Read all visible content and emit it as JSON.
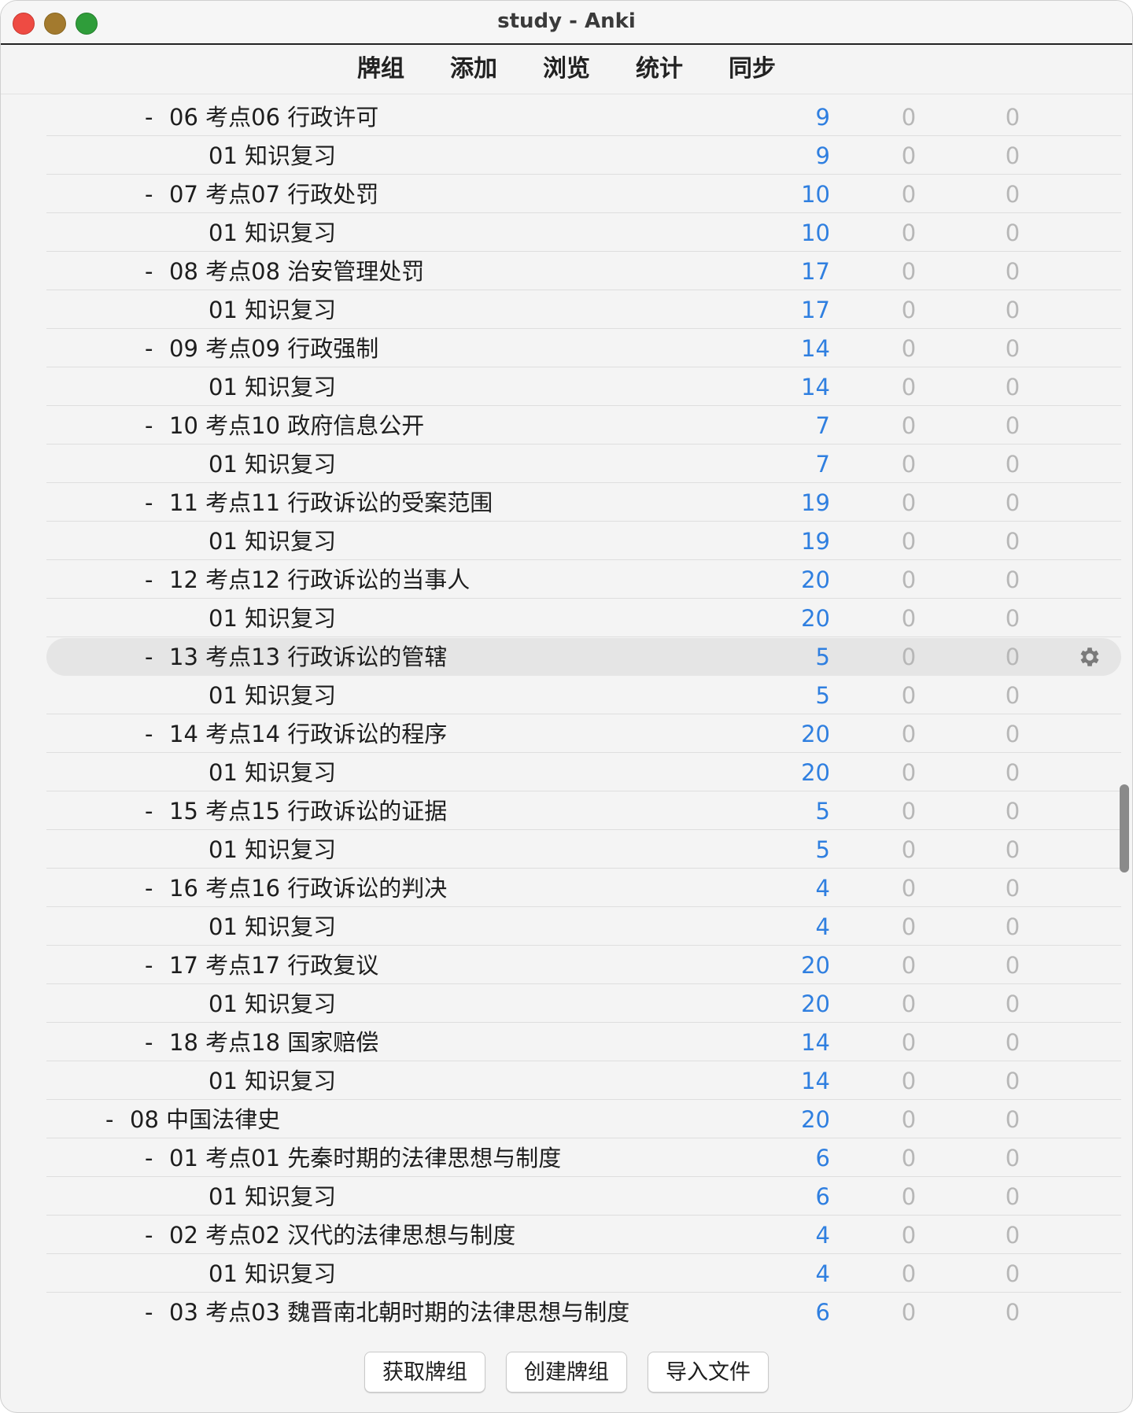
{
  "window": {
    "title": "study - Anki"
  },
  "toolbar": {
    "decks": "牌组",
    "add": "添加",
    "browse": "浏览",
    "stats": "统计",
    "sync": "同步"
  },
  "colors": {
    "due": "#2f7fe0",
    "zero": "#b7b7b7"
  },
  "decks": [
    {
      "collapse": "-",
      "name": "06 考点06 行政许可",
      "due": "9",
      "new": "0",
      "learn": "0"
    },
    {
      "collapse": "",
      "name": "01 知识复习",
      "due": "9",
      "new": "0",
      "learn": "0"
    },
    {
      "collapse": "-",
      "name": "07 考点07 行政处罚",
      "due": "10",
      "new": "0",
      "learn": "0"
    },
    {
      "collapse": "",
      "name": "01 知识复习",
      "due": "10",
      "new": "0",
      "learn": "0"
    },
    {
      "collapse": "-",
      "name": "08 考点08 治安管理处罚",
      "due": "17",
      "new": "0",
      "learn": "0"
    },
    {
      "collapse": "",
      "name": "01 知识复习",
      "due": "17",
      "new": "0",
      "learn": "0"
    },
    {
      "collapse": "-",
      "name": "09 考点09 行政强制",
      "due": "14",
      "new": "0",
      "learn": "0"
    },
    {
      "collapse": "",
      "name": "01 知识复习",
      "due": "14",
      "new": "0",
      "learn": "0"
    },
    {
      "collapse": "-",
      "name": "10 考点10 政府信息公开",
      "due": "7",
      "new": "0",
      "learn": "0"
    },
    {
      "collapse": "",
      "name": "01 知识复习",
      "due": "7",
      "new": "0",
      "learn": "0"
    },
    {
      "collapse": "-",
      "name": "11 考点11 行政诉讼的受案范围",
      "due": "19",
      "new": "0",
      "learn": "0"
    },
    {
      "collapse": "",
      "name": "01 知识复习",
      "due": "19",
      "new": "0",
      "learn": "0"
    },
    {
      "collapse": "-",
      "name": "12 考点12 行政诉讼的当事人",
      "due": "20",
      "new": "0",
      "learn": "0"
    },
    {
      "collapse": "",
      "name": "01 知识复习",
      "due": "20",
      "new": "0",
      "learn": "0"
    },
    {
      "collapse": "-",
      "name": "13 考点13 行政诉讼的管辖",
      "due": "5",
      "new": "0",
      "learn": "0"
    },
    {
      "collapse": "",
      "name": "01 知识复习",
      "due": "5",
      "new": "0",
      "learn": "0"
    },
    {
      "collapse": "-",
      "name": "14 考点14 行政诉讼的程序",
      "due": "20",
      "new": "0",
      "learn": "0"
    },
    {
      "collapse": "",
      "name": "01 知识复习",
      "due": "20",
      "new": "0",
      "learn": "0"
    },
    {
      "collapse": "-",
      "name": "15 考点15 行政诉讼的证据",
      "due": "5",
      "new": "0",
      "learn": "0"
    },
    {
      "collapse": "",
      "name": "01 知识复习",
      "due": "5",
      "new": "0",
      "learn": "0"
    },
    {
      "collapse": "-",
      "name": "16 考点16 行政诉讼的判决",
      "due": "4",
      "new": "0",
      "learn": "0"
    },
    {
      "collapse": "",
      "name": "01 知识复习",
      "due": "4",
      "new": "0",
      "learn": "0"
    },
    {
      "collapse": "-",
      "name": "17 考点17 行政复议",
      "due": "20",
      "new": "0",
      "learn": "0"
    },
    {
      "collapse": "",
      "name": "01 知识复习",
      "due": "20",
      "new": "0",
      "learn": "0"
    },
    {
      "collapse": "-",
      "name": "18 考点18 国家赔偿",
      "due": "14",
      "new": "0",
      "learn": "0"
    },
    {
      "collapse": "",
      "name": "01 知识复习",
      "due": "14",
      "new": "0",
      "learn": "0"
    },
    {
      "collapse": "-",
      "name": "08 中国法律史",
      "due": "20",
      "new": "0",
      "learn": "0"
    },
    {
      "collapse": "-",
      "name": "01 考点01 先秦时期的法律思想与制度",
      "due": "6",
      "new": "0",
      "learn": "0"
    },
    {
      "collapse": "",
      "name": "01 知识复习",
      "due": "6",
      "new": "0",
      "learn": "0"
    },
    {
      "collapse": "-",
      "name": "02 考点02 汉代的法律思想与制度",
      "due": "4",
      "new": "0",
      "learn": "0"
    },
    {
      "collapse": "",
      "name": "01 知识复习",
      "due": "4",
      "new": "0",
      "learn": "0"
    },
    {
      "collapse": "-",
      "name": "03 考点03 魏晋南北朝时期的法律思想与制度",
      "due": "6",
      "new": "0",
      "learn": "0"
    }
  ],
  "current_deck": "13 考点13 行政诉讼的管辖",
  "options_icon": "gear-icon",
  "buttons": {
    "get_shared": "获取牌组",
    "create_deck": "创建牌组",
    "import_file": "导入文件"
  }
}
